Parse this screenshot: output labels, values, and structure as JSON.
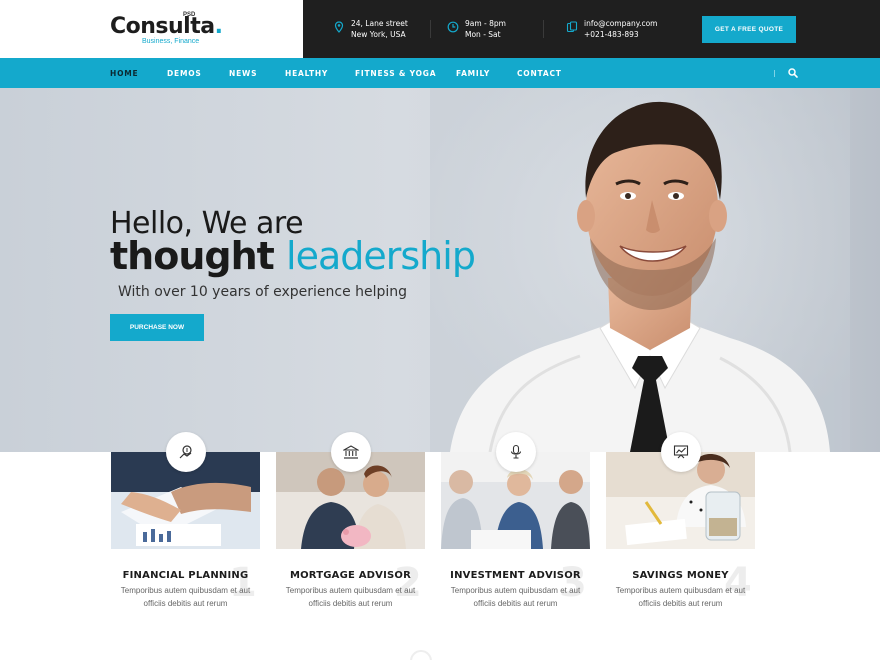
{
  "brand": {
    "name": "Consulta",
    "dot": ".",
    "psd": "PSD",
    "tagline": "Business, Finance"
  },
  "contact": {
    "address_line1": "24, Lane street",
    "address_line2": "New York, USA",
    "hours_line1": "9am - 8pm",
    "hours_line2": "Mon - Sat",
    "email": "info@company.com",
    "phone": "+021-483-893"
  },
  "quote_button": "GET A FREE QUOTE",
  "nav": [
    "HOME",
    "DEMOS",
    "NEWS",
    "HEALTHY",
    "FITNESS & YOGA",
    "FAMILY",
    "CONTACT"
  ],
  "nav_active": "HOME",
  "hero": {
    "line1": "Hello, We are",
    "line2_a": "thought",
    "line2_b": "leadership",
    "subtitle": "With over 10 years of experience helping",
    "button": "PURCHASE NOW"
  },
  "services": [
    {
      "title": "FINANCIAL PLANNING",
      "desc1": "Temporibus autem quibusdam et aut",
      "desc2": "officiis debitis aut rerum",
      "num": "1",
      "icon": "money-bag-icon"
    },
    {
      "title": "MORTGAGE ADVISOR",
      "desc1": "Temporibus autem quibusdam et aut",
      "desc2": "officiis debitis aut rerum",
      "num": "2",
      "icon": "bank-icon"
    },
    {
      "title": "INVESTMENT ADVISOR",
      "desc1": "Temporibus autem quibusdam et aut",
      "desc2": "officiis debitis aut rerum",
      "num": "3",
      "icon": "microphone-icon"
    },
    {
      "title": "SAVINGS MONEY",
      "desc1": "Temporibus autem quibusdam et aut",
      "desc2": "officiis debitis aut rerum",
      "num": "4",
      "icon": "presentation-chart-icon"
    }
  ],
  "colors": {
    "accent": "#14a9cc",
    "dark": "#1f1f1f"
  }
}
